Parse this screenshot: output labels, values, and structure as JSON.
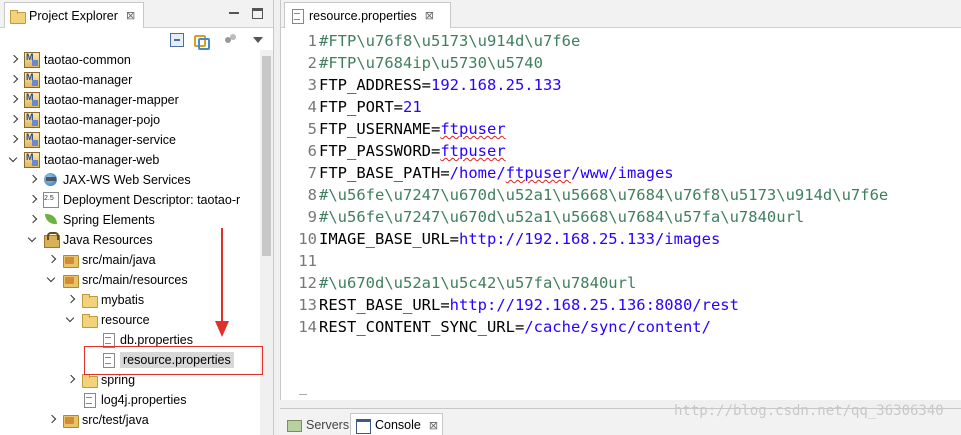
{
  "explorer": {
    "title": "Project Explorer",
    "close_glyph": "⊠",
    "tree": [
      {
        "label": "taotao-common",
        "icon": "maven-project-icon",
        "level": 0,
        "state": "collapsed"
      },
      {
        "label": "taotao-manager",
        "icon": "maven-project-icon",
        "level": 0,
        "state": "collapsed"
      },
      {
        "label": "taotao-manager-mapper",
        "icon": "maven-project-icon",
        "level": 0,
        "state": "collapsed"
      },
      {
        "label": "taotao-manager-pojo",
        "icon": "maven-project-icon",
        "level": 0,
        "state": "collapsed"
      },
      {
        "label": "taotao-manager-service",
        "icon": "maven-project-icon",
        "level": 0,
        "state": "collapsed"
      },
      {
        "label": "taotao-manager-web",
        "icon": "maven-project-icon",
        "level": 0,
        "state": "expanded"
      },
      {
        "label": "JAX-WS Web Services",
        "icon": "jaxws-icon",
        "level": 1,
        "state": "collapsed"
      },
      {
        "label": "Deployment Descriptor: taotao-r",
        "icon": "deployment-descriptor-icon",
        "level": 1,
        "state": "collapsed"
      },
      {
        "label": "Spring Elements",
        "icon": "spring-icon",
        "level": 1,
        "state": "collapsed"
      },
      {
        "label": "Java Resources",
        "icon": "java-resources-icon",
        "level": 1,
        "state": "expanded"
      },
      {
        "label": "src/main/java",
        "icon": "source-folder-icon",
        "level": 2,
        "state": "collapsed"
      },
      {
        "label": "src/main/resources",
        "icon": "source-folder-icon",
        "level": 2,
        "state": "expanded"
      },
      {
        "label": "mybatis",
        "icon": "folder-icon",
        "level": 3,
        "state": "collapsed"
      },
      {
        "label": "resource",
        "icon": "folder-icon",
        "level": 3,
        "state": "expanded"
      },
      {
        "label": "db.properties",
        "icon": "file-icon",
        "level": 4,
        "state": "leaf"
      },
      {
        "label": "resource.properties",
        "icon": "file-icon",
        "level": 4,
        "state": "leaf",
        "selected": true
      },
      {
        "label": "spring",
        "icon": "folder-icon",
        "level": 3,
        "state": "collapsed"
      },
      {
        "label": "log4j.properties",
        "icon": "file-icon",
        "level": 3,
        "state": "leaf"
      },
      {
        "label": "src/test/java",
        "icon": "source-folder-icon",
        "level": 2,
        "state": "collapsed"
      }
    ]
  },
  "editor": {
    "tab_title": "resource.properties",
    "close_glyph": "⊠",
    "lines": [
      {
        "num": "1",
        "parts": [
          {
            "t": "#FTP\\u76f8\\u5173\\u914d\\u7f6e",
            "c": "cmt"
          }
        ]
      },
      {
        "num": "2",
        "parts": [
          {
            "t": "#FTP\\u7684ip\\u5730\\u5740",
            "c": "cmt"
          }
        ]
      },
      {
        "num": "3",
        "parts": [
          {
            "t": "FTP_ADDRESS=",
            "c": "key"
          },
          {
            "t": "192.168.25.133",
            "c": "val"
          }
        ]
      },
      {
        "num": "4",
        "parts": [
          {
            "t": "FTP_PORT=",
            "c": "key"
          },
          {
            "t": "21",
            "c": "val"
          }
        ]
      },
      {
        "num": "5",
        "parts": [
          {
            "t": "FTP_USERNAME=",
            "c": "key"
          },
          {
            "t": "ftpuser",
            "c": "val squig"
          }
        ]
      },
      {
        "num": "6",
        "parts": [
          {
            "t": "FTP_PASSWORD=",
            "c": "key"
          },
          {
            "t": "ftpuser",
            "c": "val squig"
          }
        ]
      },
      {
        "num": "7",
        "parts": [
          {
            "t": "FTP_BASE_PATH=",
            "c": "key"
          },
          {
            "t": "/home/",
            "c": "val"
          },
          {
            "t": "ftpuser",
            "c": "val squig"
          },
          {
            "t": "/www/images",
            "c": "val"
          }
        ]
      },
      {
        "num": "8",
        "parts": [
          {
            "t": "#\\u56fe\\u7247\\u670d\\u52a1\\u5668\\u7684\\u76f8\\u5173\\u914d\\u7f6e",
            "c": "cmt"
          }
        ]
      },
      {
        "num": "9",
        "parts": [
          {
            "t": "#\\u56fe\\u7247\\u670d\\u52a1\\u5668\\u7684\\u57fa\\u7840url",
            "c": "cmt"
          }
        ]
      },
      {
        "num": "10",
        "parts": [
          {
            "t": "IMAGE_BASE_URL=",
            "c": "key"
          },
          {
            "t": "http://192.168.25.133/images",
            "c": "val"
          }
        ]
      },
      {
        "num": "11",
        "parts": []
      },
      {
        "num": "12",
        "parts": [
          {
            "t": "#\\u670d\\u52a1\\u5c42\\u57fa\\u7840url",
            "c": "cmt"
          }
        ]
      },
      {
        "num": "13",
        "parts": [
          {
            "t": "REST_BASE_URL=",
            "c": "key"
          },
          {
            "t": "http://192.168.25.136:8080/rest",
            "c": "val"
          }
        ]
      },
      {
        "num": "14",
        "parts": [
          {
            "t": "REST_CONTENT_SYNC_URL=",
            "c": "key"
          },
          {
            "t": "/cache/sync/content/",
            "c": "val"
          }
        ]
      }
    ]
  },
  "bottom": {
    "servers_label": "Servers",
    "console_label": "Console",
    "close_glyph": "⊠",
    "watermark": "http://blog.csdn.net/qq_36306340"
  },
  "colors": {
    "comment": "#3f7f5f",
    "value": "#2a00ff",
    "annotation": "#e0302a"
  }
}
